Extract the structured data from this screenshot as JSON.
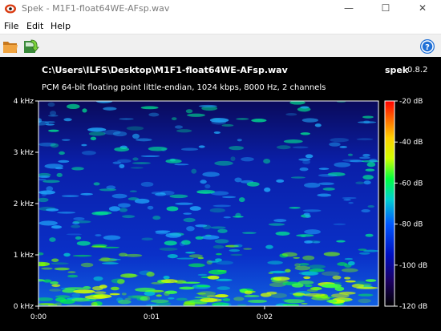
{
  "window": {
    "title": "Spek - M1F1-float64WE-AFsp.wav",
    "minimize_glyph": "—",
    "maximize_glyph": "☐",
    "close_glyph": "✕",
    "icon": "spek-app-icon"
  },
  "menu": {
    "items": [
      "File",
      "Edit",
      "Help"
    ]
  },
  "toolbar": {
    "open_icon": "folder-icon",
    "save_icon": "save-arrow-icon",
    "about_icon": "info-icon",
    "about_glyph": "?"
  },
  "spectrogram": {
    "file_path": "C:\\Users\\ILFS\\Desktop\\M1F1-float64WE-AFsp.wav",
    "info": "PCM 64-bit floating point little-endian, 1024 kbps, 8000 Hz, 2 channels",
    "brand": "spek",
    "version": "0.8.2",
    "background_color": "#000000"
  },
  "chart_data": {
    "type": "heatmap",
    "title": "C:\\Users\\ILFS\\Desktop\\M1F1-float64WE-AFsp.wav",
    "subtitle": "PCM 64-bit floating point little-endian, 1024 kbps, 8000 Hz, 2 channels",
    "x_ticks": [
      "0:00",
      "0:01",
      "0:02"
    ],
    "y_ticks": [
      "0 kHz",
      "1 kHz",
      "2 kHz",
      "3 kHz",
      "4 kHz"
    ],
    "colorbar_ticks": [
      "-20 dB",
      "-40 dB",
      "-60 dB",
      "-80 dB",
      "-100 dB",
      "-120 dB"
    ],
    "colorbar_range_db": [
      -120,
      -20
    ],
    "y_range_khz": [
      0,
      4
    ],
    "colormap": [
      "#000000",
      "#1c0060",
      "#0010c0",
      "#0058ff",
      "#00d0d0",
      "#00ff40",
      "#d0ff00",
      "#ffd000",
      "#ff6000",
      "#ff0000"
    ]
  }
}
